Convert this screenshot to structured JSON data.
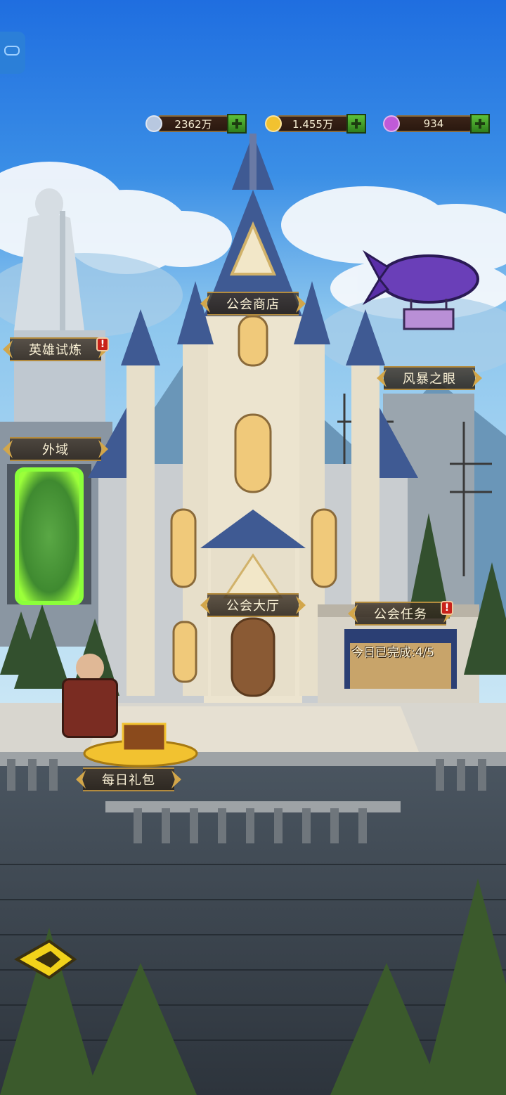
{
  "resources": [
    {
      "name": "silver-coin",
      "value": "2362万",
      "icon_color": "#b8c8e0"
    },
    {
      "name": "gold-coin",
      "value": "1.455万",
      "icon_color": "#f2c230"
    },
    {
      "name": "purple-gem",
      "value": "934",
      "icon_color": "#c05ad8"
    }
  ],
  "buildings": {
    "guild_shop": "公会商店",
    "hero_trial": "英雄试炼",
    "storm_eye": "风暴之眼",
    "outer_realm": "外域",
    "guild_hall": "公会大厅",
    "guild_task": "公会任务",
    "daily_gift": "每日礼包"
  },
  "task_progress": "今日已完成:4/5",
  "alert_mark": "!",
  "colors": {
    "sky_top": "#1f6ee0",
    "sky_bottom": "#9fd0f0",
    "accent_gold": "#d2a64a",
    "portal_green": "#7bff3a"
  }
}
